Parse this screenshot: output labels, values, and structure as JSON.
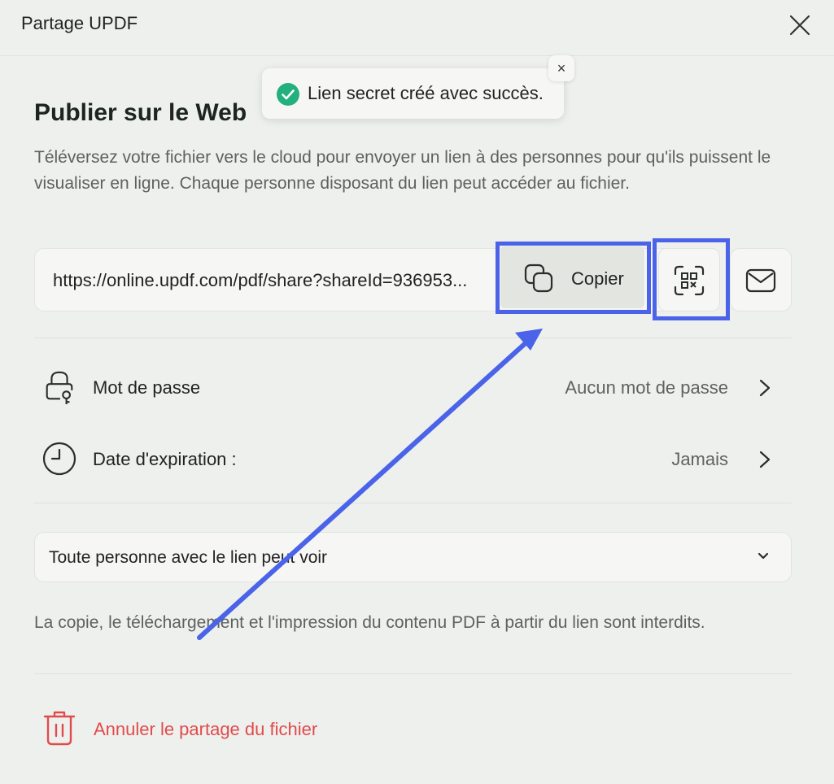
{
  "window": {
    "title": "Partage UPDF"
  },
  "toast": {
    "message": "Lien secret créé avec succès.",
    "close_glyph": "×"
  },
  "header": {
    "title": "Publier sur le Web"
  },
  "description": "Téléversez votre fichier vers le cloud pour envoyer un lien à des personnes pour qu'ils puissent le visualiser en ligne. Chaque personne disposant du lien peut accéder au fichier.",
  "link": {
    "url": "https://online.updf.com/pdf/share?shareId=936953...",
    "copy_label": "Copier"
  },
  "settings": {
    "password": {
      "label": "Mot de passe",
      "value": "Aucun mot de passe"
    },
    "expiration": {
      "label": "Date d'expiration :",
      "value": "Jamais"
    }
  },
  "access": {
    "selected": "Toute personne avec le lien peut voir"
  },
  "notice": "La copie, le téléchargement et l'impression du contenu PDF à partir du lien sont interdits.",
  "unshare": {
    "label": "Annuler le partage du fichier"
  },
  "colors": {
    "accent_annotation": "#4a63e8",
    "success": "#22b07d",
    "danger": "#e14b4b",
    "background": "#eef0ee"
  },
  "icons": [
    "close-icon",
    "check-circle-icon",
    "copy-icon",
    "qr-code-icon",
    "mail-icon",
    "lock-icon",
    "clock-icon",
    "chevron-right-icon",
    "chevron-down-icon",
    "trash-icon"
  ]
}
